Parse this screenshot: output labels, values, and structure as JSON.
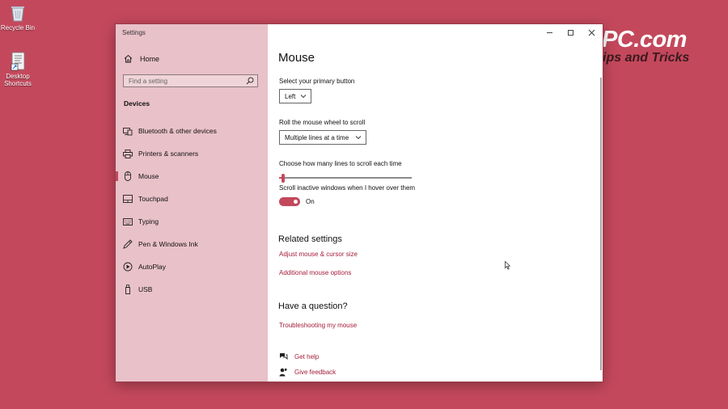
{
  "desktop": {
    "recycle_bin": "Recycle Bin",
    "shortcut_line1": "Desktop",
    "shortcut_line2": "Shortcuts",
    "watermark_line1": "PC.com",
    "watermark_line2": "ips and Tricks"
  },
  "window": {
    "title": "Settings",
    "controls": [
      "minimize-icon",
      "maximize-icon",
      "close-icon"
    ]
  },
  "sidebar": {
    "home_label": "Home",
    "search_placeholder": "Find a setting",
    "section": "Devices",
    "items": [
      {
        "label": "Bluetooth & other devices",
        "icon": "bluetooth-devices-icon"
      },
      {
        "label": "Printers & scanners",
        "icon": "printer-icon"
      },
      {
        "label": "Mouse",
        "icon": "mouse-icon",
        "active": true
      },
      {
        "label": "Touchpad",
        "icon": "touchpad-icon"
      },
      {
        "label": "Typing",
        "icon": "keyboard-icon"
      },
      {
        "label": "Pen & Windows Ink",
        "icon": "pen-icon"
      },
      {
        "label": "AutoPlay",
        "icon": "autoplay-icon"
      },
      {
        "label": "USB",
        "icon": "usb-icon"
      }
    ]
  },
  "main": {
    "title": "Mouse",
    "primary_button_label": "Select your primary button",
    "primary_button_value": "Left",
    "scroll_label": "Roll the mouse wheel to scroll",
    "scroll_value": "Multiple lines at a time",
    "lines_label": "Choose how many lines to scroll each time",
    "lines_slider_fraction": 0.03,
    "inactive_label": "Scroll inactive windows when I hover over them",
    "inactive_toggle": "On",
    "related_heading": "Related settings",
    "related_links": [
      "Adjust mouse & cursor size",
      "Additional mouse options"
    ],
    "question_heading": "Have a question?",
    "question_link": "Troubleshooting my mouse",
    "get_help": "Get help",
    "give_feedback": "Give feedback"
  },
  "colors": {
    "accent": "#c4485c",
    "link": "#a51d3a",
    "sidebar_bg": "#e9c1c9",
    "desktop_bg": "#c4485c"
  }
}
